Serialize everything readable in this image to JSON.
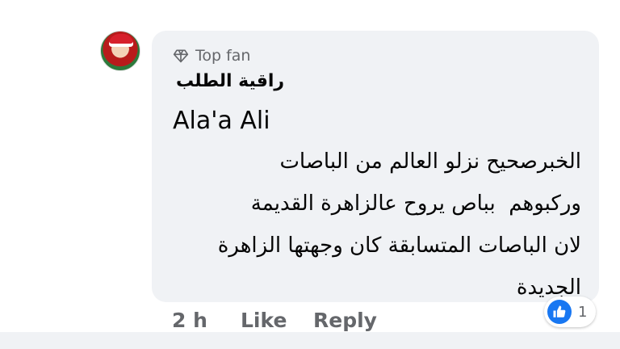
{
  "comment": {
    "badge_label": "Top fan",
    "author_name": "راقية الطلب",
    "mention": "Ala'a Ali",
    "body": "الخبرصحيح نزلو العالم من الباصات\nوركبوهم  بباص يروح عالزاهرة القديمة\nلان الباصات المتسابقة كان وجهتها الزاهرة\nالجديدة"
  },
  "actions": {
    "time": "2 h",
    "like_label": "Like",
    "reply_label": "Reply"
  },
  "reactions": {
    "icon": "thumbs-up-icon",
    "count": "1"
  },
  "colors": {
    "bubble": "#f0f2f5",
    "meta_text": "#65676b",
    "like_blue": "#1877f2"
  }
}
